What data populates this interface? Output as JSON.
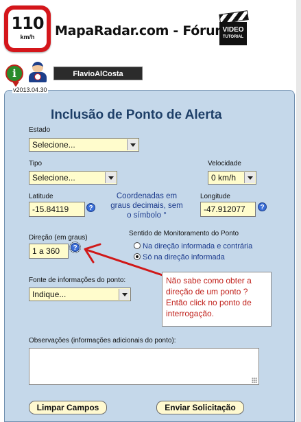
{
  "header": {
    "logo_number": "110",
    "logo_unit": "km/h",
    "site_title": "MapaRadar.com - Fórum",
    "video_label": "VIDEO",
    "video_sub": "TUTORIAL"
  },
  "user": {
    "name": "FlavioAlCosta",
    "version": "v2013.04.30",
    "info_glyph": "i",
    "icons": [
      "info-pin-icon",
      "user-avatar-icon",
      "video-tutorial-icon"
    ]
  },
  "form": {
    "title": "Inclusão de Ponto de Alerta",
    "estado": {
      "label": "Estado",
      "value": "Selecione..."
    },
    "tipo": {
      "label": "Tipo",
      "value": "Selecione..."
    },
    "velocidade": {
      "label": "Velocidade",
      "value": "0 km/h"
    },
    "latitude": {
      "label": "Latitude",
      "value": "-15.84119"
    },
    "coord_note": "Coordenadas em graus decimais, sem o símbolo °",
    "longitude": {
      "label": "Longitude",
      "value": "-47.912077"
    },
    "direcao": {
      "label": "Direção (em graus)",
      "value": "1 a 360"
    },
    "sentido": {
      "label": "Sentido de Monitoramento do Ponto",
      "option1": "Na direção informada e contrária",
      "option2": "Só na direção informada",
      "selected": 2
    },
    "fonte": {
      "label": "Fonte de informações do ponto:",
      "value": "Indique..."
    },
    "observacoes": {
      "label": "Observações (informações adicionais do ponto):",
      "value": ""
    },
    "help_glyph": "?",
    "buttons": {
      "clear": "Limpar Campos",
      "submit": "Enviar Solicitação"
    }
  },
  "callout": {
    "text": "Não sabe como obter a direção de um ponto ? Então click no ponto de interrogação."
  },
  "colors": {
    "panel_bg": "#c5d8ea",
    "field_bg": "#fffccc",
    "title_color": "#1e3f68",
    "callout_text": "#c0201a",
    "arrow": "#d01818"
  }
}
